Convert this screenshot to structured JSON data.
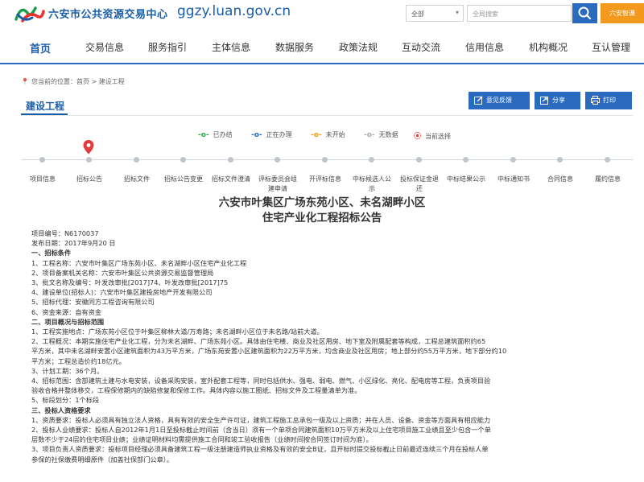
{
  "header": {
    "site_name": "六安市公共资源交易中心",
    "domain": "ggzy.luan.gov.cn",
    "search_scope": "全部",
    "search_placeholder": "全局搜索",
    "login_label": "六安智课"
  },
  "nav": {
    "items": [
      "首页",
      "交易信息",
      "服务指引",
      "主体信息",
      "数据服务",
      "政策法规",
      "互动交流",
      "信用信息",
      "机构概况",
      "互认管理"
    ]
  },
  "breadcrumb": "您当前的位置：首页 > 建设工程",
  "section_title": "建设工程",
  "actions": [
    "意见反馈",
    "分享",
    "打印"
  ],
  "legend": [
    {
      "marker": "-o-",
      "label": "已办结",
      "color": "#2aa84a"
    },
    {
      "marker": "-o-",
      "label": "正在办理",
      "color": "#2a6bbf"
    },
    {
      "marker": "-o-",
      "label": "未开始",
      "color": "#f39a1e"
    },
    {
      "marker": "-o-",
      "label": "无数据",
      "color": "#aaaaaa"
    },
    {
      "marker": "⦿",
      "label": "当前选择",
      "color": "#e23b3b"
    }
  ],
  "steps": [
    "项目信息",
    "招标公告",
    "招标文件",
    "招标公告变更",
    "招标文件澄清",
    "评标委员会组建申请",
    "开评标信息",
    "中标候选人公示",
    "投标保证金退还",
    "中标结果公示",
    "中标通知书",
    "合同信息",
    "履约信息"
  ],
  "doc": {
    "title1": "六安市叶集区广场东苑小区、未名湖畔小区",
    "title2": "住宅产业化工程招标公告",
    "lines": [
      "项目编号：N6170037",
      "发布日期：2017年9月20 日",
      "一、招标条件",
      "    1、工程名称：六安市叶集区广场东苑小区、未名湖畔小区住宅产业化工程",
      "    2、项目备案机关名称：六安市叶集区公共资源交易监督管理局",
      "    3、批文名称及编号：叶发改审批[2017]74、叶发改审批[2017]75",
      "    4、建设单位(招标人)：六安市叶集区建投房地产开发有限公司",
      "    5、招标代理：安徽同方工程咨询有限公司",
      "  6、资金来源：自有资金",
      "二、项目概况与招标范围",
      "    1、工程实施地点：广场东苑小区位于叶集区柳林大道/万寿路；未名湖畔小区位于未名路/站前大道。",
      "    2、工程概况：本期实施住宅产业化工程，分为未名湖畔、广场东苑小区。具体由住宅楼、商业及社区用房、地下室及附属配套等构成，工程总建筑面积约65",
      "平方米，其中未名湖畔安置小区建筑面积为43万平方米，广场东苑安置小区建筑面积为22万平方米，均含商业及社区用房；地上部分约55万平方米，地下部分约10",
      "平方米；工程总造价约18亿元。",
      "    3、计划工期：36个月。",
      "    4、招标范围：含部建筑土建与水电安装，设备采购安装，室外配套工程等，同时包括供水、强电、弱电、燃气、小区绿化、亮化、配电房等工程，负责项目验",
      "验收合格并整体移交，工程保修期内的缺陷修复和保修工作。具体内容以施工图纸、招标文件及工程量清单为准。",
      "          5、标段划分：1个标段",
      "三、投标人资格要求",
      "    1、资质要求：投标人必须具有独立法人资格，具有有效的安全生产许可证，建筑工程施工总承包一级及以上资质；并在人员、设备、资金等方面具有相应能力",
      "    2、投标人业绩要求：投标人自2012年1月1日至投标截止时间前（含当日）须有一个单项合同建筑面积10万平方米及以上住宅项目施工业绩且至少包含一个单",
      "层数不少于24层的住宅项目业绩；业绩证明材料均需提供施工合同和竣工验收报告（业绩时间按合同签订时间为准）。",
      "    3、项目负责人资质要求：投标项目经理必须具备建筑工程一级注册建造师执业资格及有效的安全B证，且开标时提交投标截止日前最近连续三个月在投标人单",
      "参保的社保缴费明细原件（加盖社保部门公章）。"
    ]
  },
  "colors": {
    "brand_blue": "#1a5ea8",
    "button_blue": "#2a6bbf",
    "orange": "#f39a1e"
  }
}
